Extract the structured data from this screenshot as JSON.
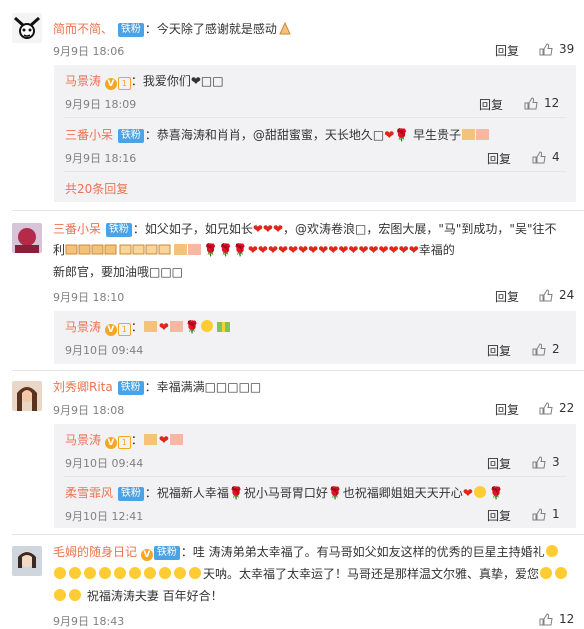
{
  "comments": [
    {
      "name": "简而不简、",
      "badge": "铁粉",
      "text": "今天除了感谢就是感动",
      "time": "9月9日 18:06",
      "reply": "回复",
      "likes": "39",
      "replies": [
        {
          "name": "马景涛",
          "text": "我爱你们❤□□",
          "time": "9月9日 18:09",
          "reply": "回复",
          "likes": "12"
        },
        {
          "name": "三番小呆",
          "badge": "铁粉",
          "text": "恭喜海涛和肖肖，@甜甜蜜蜜，天长地久□",
          "text2": "早生贵子",
          "time": "9月9日 18:16",
          "reply": "回复",
          "likes": "4"
        }
      ],
      "more": "共20条回复"
    },
    {
      "name": "三番小呆",
      "badge": "铁粉",
      "text1a": "如父如子，如兄如长",
      "text1b": "，@欢涛卷浪□，宏图大展，\"马\"到成功，\"吴\"往不",
      "text2a": "利",
      "text2b": "幸福的",
      "text3": "新郎官，要加油哦□□□",
      "time": "9月9日 18:10",
      "reply": "回复",
      "likes": "24",
      "replies": [
        {
          "name": "马景涛",
          "time": "9月10日 09:44",
          "reply": "回复",
          "likes": "2"
        }
      ]
    },
    {
      "name": "刘秀卿Rita",
      "badge": "铁粉",
      "text": "幸福满满□□□□□",
      "time": "9月9日 18:08",
      "reply": "回复",
      "likes": "22",
      "replies": [
        {
          "name": "马景涛",
          "time": "9月10日 09:44",
          "reply": "回复",
          "likes": "3"
        },
        {
          "name": "柔雪霏风",
          "badge": "铁粉",
          "text1": "祝福新人幸福",
          "text2": "祝小马哥胃口好",
          "text3": "也祝福卿姐姐天天开心",
          "time": "9月10日 12:41",
          "reply": "回复",
          "likes": "1"
        }
      ]
    },
    {
      "name": "毛姆的随身日记",
      "badge": "铁粉",
      "text1": "哇 涛涛弟弟太幸福了。有马哥如父如友这样的优秀的巨星主持婚礼",
      "text2": "天呐。太幸福了太幸运了！马哥还是那样温文尔雅、真挚，爱您",
      "text3": "祝福涛涛夫妻 百年好合！",
      "time": "9月9日 18:43",
      "likes": "12"
    }
  ],
  "colors": {
    "name": "#eb7350",
    "badge": "#4aa3e6",
    "reply_bg": "#f2f2f5",
    "heart": "#e0251b"
  }
}
